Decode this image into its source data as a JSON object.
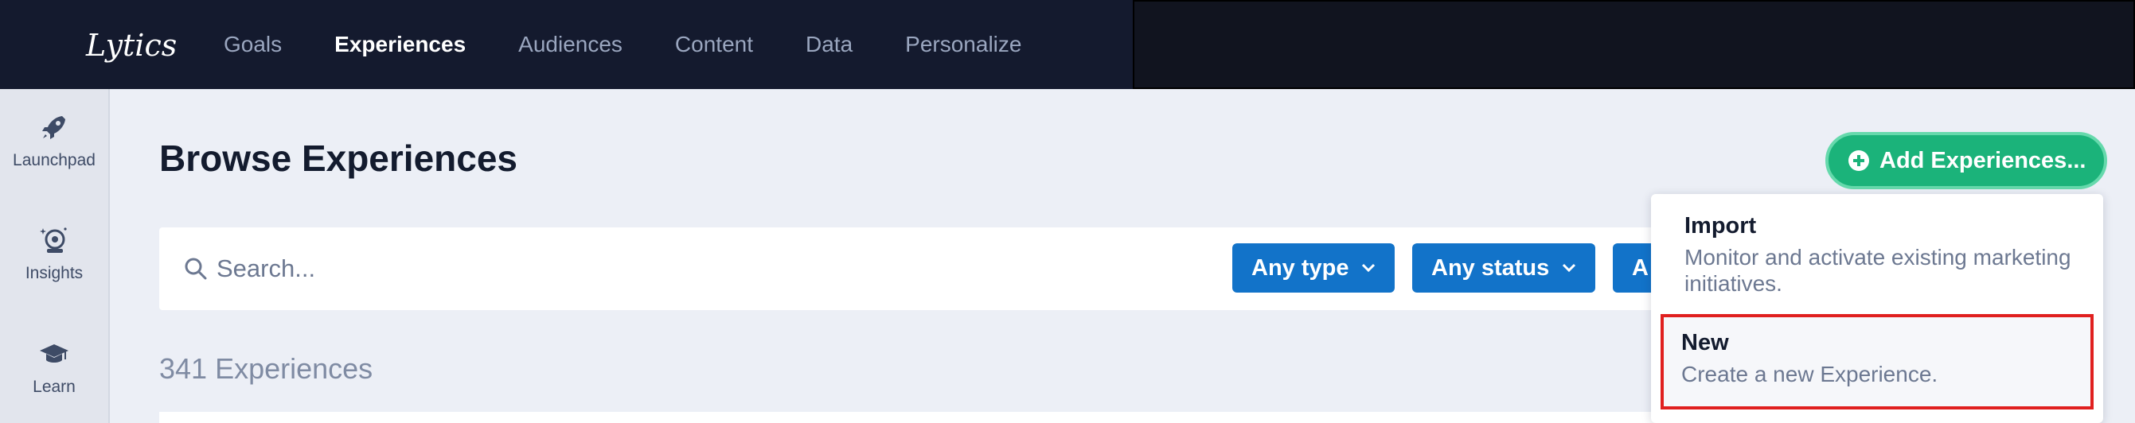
{
  "brand": {
    "logo_text": "Lytics"
  },
  "nav": {
    "items": [
      {
        "label": "Goals",
        "active": false
      },
      {
        "label": "Experiences",
        "active": true
      },
      {
        "label": "Audiences",
        "active": false
      },
      {
        "label": "Content",
        "active": false
      },
      {
        "label": "Data",
        "active": false
      },
      {
        "label": "Personalize",
        "active": false
      }
    ]
  },
  "sidebar": {
    "items": [
      {
        "label": "Launchpad",
        "icon": "rocket-icon"
      },
      {
        "label": "Insights",
        "icon": "crystal-ball-icon"
      },
      {
        "label": "Learn",
        "icon": "graduation-cap-icon"
      }
    ]
  },
  "main": {
    "title": "Browse Experiences",
    "search": {
      "placeholder": "Search..."
    },
    "filters": [
      "Any type",
      "Any status",
      "A"
    ],
    "count_text": "341 Experiences"
  },
  "add_button": {
    "label": "Add Experiences..."
  },
  "dropdown": {
    "items": [
      {
        "title": "Import",
        "description": "Monitor and activate existing marketing initiatives."
      },
      {
        "title": "New",
        "description": "Create a new Experience."
      }
    ]
  },
  "colors": {
    "nav_bg": "#141a2e",
    "accent_blue": "#1273c9",
    "accent_green": "#1bb37a",
    "highlight_red": "#e0201f"
  }
}
